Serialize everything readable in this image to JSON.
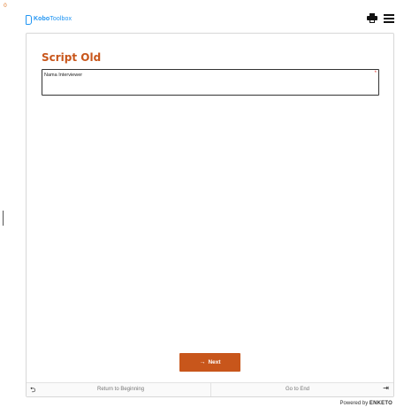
{
  "corner_counter": "0",
  "header": {
    "logo_bold": "Kobo",
    "logo_light": "Toolbox",
    "print_icon": "printer-icon",
    "menu_icon": "hamburger-menu-icon"
  },
  "form": {
    "title": "Script Old",
    "questions": [
      {
        "label": "Nama Interviewer",
        "required_mark": "*",
        "value": ""
      }
    ],
    "next_label": "Next",
    "next_icon": "→"
  },
  "bottom_nav": {
    "return_icon": "⮌",
    "return_label": "Return to Beginning",
    "end_label": "Go to End",
    "end_icon": "⇥"
  },
  "footer": {
    "powered_by": "Powered by",
    "brand": "ENKETO"
  },
  "colors": {
    "accent": "#c8561b",
    "logo_blue": "#2095f3",
    "required_red": "#e5322d"
  }
}
